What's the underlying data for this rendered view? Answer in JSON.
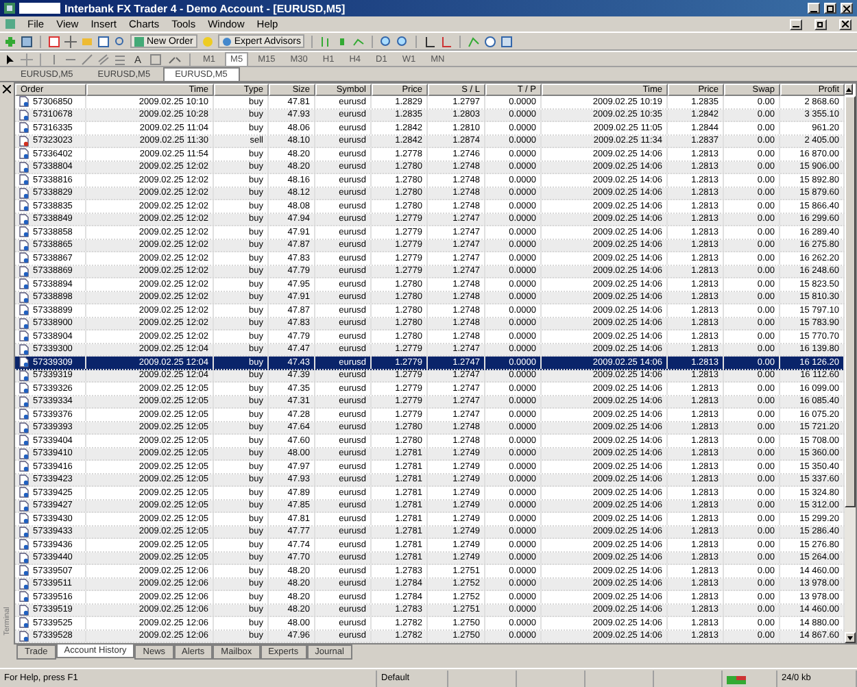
{
  "window": {
    "title": "Interbank FX Trader 4 - Demo Account - [EURUSD,M5]"
  },
  "menu": [
    "File",
    "View",
    "Insert",
    "Charts",
    "Tools",
    "Window",
    "Help"
  ],
  "toolbar": {
    "new_order": "New Order",
    "expert_advisors": "Expert Advisors"
  },
  "drawing_toolbar": {
    "text_tool": "A"
  },
  "timeframes": [
    {
      "label": "M1",
      "selected": false
    },
    {
      "label": "M5",
      "selected": true
    },
    {
      "label": "M15",
      "selected": false
    },
    {
      "label": "M30",
      "selected": false
    },
    {
      "label": "H1",
      "selected": false
    },
    {
      "label": "H4",
      "selected": false
    },
    {
      "label": "D1",
      "selected": false
    },
    {
      "label": "W1",
      "selected": false
    },
    {
      "label": "MN",
      "selected": false
    }
  ],
  "chart_tabs": [
    {
      "label": "EURUSD,M5",
      "selected": false
    },
    {
      "label": "EURUSD,M5",
      "selected": false
    },
    {
      "label": "EURUSD,M5",
      "selected": true
    }
  ],
  "terminal": {
    "side_label": "Terminal"
  },
  "table": {
    "columns": [
      "Order",
      "Time",
      "Type",
      "Size",
      "Symbol",
      "Price",
      "S / L",
      "T / P",
      "Time",
      "Price",
      "Swap",
      "Profit"
    ],
    "rows": [
      {
        "kind": "buy",
        "selected": false,
        "cells": [
          "57306850",
          "2009.02.25 10:10",
          "buy",
          "47.81",
          "eurusd",
          "1.2829",
          "1.2797",
          "0.0000",
          "2009.02.25 10:19",
          "1.2835",
          "0.00",
          "2 868.60"
        ]
      },
      {
        "kind": "buy",
        "selected": false,
        "cells": [
          "57310678",
          "2009.02.25 10:28",
          "buy",
          "47.93",
          "eurusd",
          "1.2835",
          "1.2803",
          "0.0000",
          "2009.02.25 10:35",
          "1.2842",
          "0.00",
          "3 355.10"
        ]
      },
      {
        "kind": "buy",
        "selected": false,
        "cells": [
          "57316335",
          "2009.02.25 11:04",
          "buy",
          "48.06",
          "eurusd",
          "1.2842",
          "1.2810",
          "0.0000",
          "2009.02.25 11:05",
          "1.2844",
          "0.00",
          "961.20"
        ]
      },
      {
        "kind": "sell",
        "selected": false,
        "cells": [
          "57323023",
          "2009.02.25 11:30",
          "sell",
          "48.10",
          "eurusd",
          "1.2842",
          "1.2874",
          "0.0000",
          "2009.02.25 11:34",
          "1.2837",
          "0.00",
          "2 405.00"
        ]
      },
      {
        "kind": "buy",
        "selected": false,
        "cells": [
          "57336402",
          "2009.02.25 11:54",
          "buy",
          "48.20",
          "eurusd",
          "1.2778",
          "1.2746",
          "0.0000",
          "2009.02.25 14:06",
          "1.2813",
          "0.00",
          "16 870.00"
        ]
      },
      {
        "kind": "buy",
        "selected": false,
        "cells": [
          "57338804",
          "2009.02.25 12:02",
          "buy",
          "48.20",
          "eurusd",
          "1.2780",
          "1.2748",
          "0.0000",
          "2009.02.25 14:06",
          "1.2813",
          "0.00",
          "15 906.00"
        ]
      },
      {
        "kind": "buy",
        "selected": false,
        "cells": [
          "57338816",
          "2009.02.25 12:02",
          "buy",
          "48.16",
          "eurusd",
          "1.2780",
          "1.2748",
          "0.0000",
          "2009.02.25 14:06",
          "1.2813",
          "0.00",
          "15 892.80"
        ]
      },
      {
        "kind": "buy",
        "selected": false,
        "cells": [
          "57338829",
          "2009.02.25 12:02",
          "buy",
          "48.12",
          "eurusd",
          "1.2780",
          "1.2748",
          "0.0000",
          "2009.02.25 14:06",
          "1.2813",
          "0.00",
          "15 879.60"
        ]
      },
      {
        "kind": "buy",
        "selected": false,
        "cells": [
          "57338835",
          "2009.02.25 12:02",
          "buy",
          "48.08",
          "eurusd",
          "1.2780",
          "1.2748",
          "0.0000",
          "2009.02.25 14:06",
          "1.2813",
          "0.00",
          "15 866.40"
        ]
      },
      {
        "kind": "buy",
        "selected": false,
        "cells": [
          "57338849",
          "2009.02.25 12:02",
          "buy",
          "47.94",
          "eurusd",
          "1.2779",
          "1.2747",
          "0.0000",
          "2009.02.25 14:06",
          "1.2813",
          "0.00",
          "16 299.60"
        ]
      },
      {
        "kind": "buy",
        "selected": false,
        "cells": [
          "57338858",
          "2009.02.25 12:02",
          "buy",
          "47.91",
          "eurusd",
          "1.2779",
          "1.2747",
          "0.0000",
          "2009.02.25 14:06",
          "1.2813",
          "0.00",
          "16 289.40"
        ]
      },
      {
        "kind": "buy",
        "selected": false,
        "cells": [
          "57338865",
          "2009.02.25 12:02",
          "buy",
          "47.87",
          "eurusd",
          "1.2779",
          "1.2747",
          "0.0000",
          "2009.02.25 14:06",
          "1.2813",
          "0.00",
          "16 275.80"
        ]
      },
      {
        "kind": "buy",
        "selected": false,
        "cells": [
          "57338867",
          "2009.02.25 12:02",
          "buy",
          "47.83",
          "eurusd",
          "1.2779",
          "1.2747",
          "0.0000",
          "2009.02.25 14:06",
          "1.2813",
          "0.00",
          "16 262.20"
        ]
      },
      {
        "kind": "buy",
        "selected": false,
        "cells": [
          "57338869",
          "2009.02.25 12:02",
          "buy",
          "47.79",
          "eurusd",
          "1.2779",
          "1.2747",
          "0.0000",
          "2009.02.25 14:06",
          "1.2813",
          "0.00",
          "16 248.60"
        ]
      },
      {
        "kind": "buy",
        "selected": false,
        "cells": [
          "57338894",
          "2009.02.25 12:02",
          "buy",
          "47.95",
          "eurusd",
          "1.2780",
          "1.2748",
          "0.0000",
          "2009.02.25 14:06",
          "1.2813",
          "0.00",
          "15 823.50"
        ]
      },
      {
        "kind": "buy",
        "selected": false,
        "cells": [
          "57338898",
          "2009.02.25 12:02",
          "buy",
          "47.91",
          "eurusd",
          "1.2780",
          "1.2748",
          "0.0000",
          "2009.02.25 14:06",
          "1.2813",
          "0.00",
          "15 810.30"
        ]
      },
      {
        "kind": "buy",
        "selected": false,
        "cells": [
          "57338899",
          "2009.02.25 12:02",
          "buy",
          "47.87",
          "eurusd",
          "1.2780",
          "1.2748",
          "0.0000",
          "2009.02.25 14:06",
          "1.2813",
          "0.00",
          "15 797.10"
        ]
      },
      {
        "kind": "buy",
        "selected": false,
        "cells": [
          "57338900",
          "2009.02.25 12:02",
          "buy",
          "47.83",
          "eurusd",
          "1.2780",
          "1.2748",
          "0.0000",
          "2009.02.25 14:06",
          "1.2813",
          "0.00",
          "15 783.90"
        ]
      },
      {
        "kind": "buy",
        "selected": false,
        "cells": [
          "57338904",
          "2009.02.25 12:02",
          "buy",
          "47.79",
          "eurusd",
          "1.2780",
          "1.2748",
          "0.0000",
          "2009.02.25 14:06",
          "1.2813",
          "0.00",
          "15 770.70"
        ]
      },
      {
        "kind": "buy",
        "selected": false,
        "cells": [
          "57339300",
          "2009.02.25 12:04",
          "buy",
          "47.47",
          "eurusd",
          "1.2779",
          "1.2747",
          "0.0000",
          "2009.02.25 14:06",
          "1.2813",
          "0.00",
          "16 139.80"
        ]
      },
      {
        "kind": "buy",
        "selected": true,
        "cells": [
          "57339309",
          "2009.02.25 12:04",
          "buy",
          "47.43",
          "eurusd",
          "1.2779",
          "1.2747",
          "0.0000",
          "2009.02.25 14:06",
          "1.2813",
          "0.00",
          "16 126.20"
        ]
      },
      {
        "kind": "buy",
        "selected": false,
        "cells": [
          "57339319",
          "2009.02.25 12:04",
          "buy",
          "47.39",
          "eurusd",
          "1.2779",
          "1.2747",
          "0.0000",
          "2009.02.25 14:06",
          "1.2813",
          "0.00",
          "16 112.60"
        ]
      },
      {
        "kind": "buy",
        "selected": false,
        "cells": [
          "57339326",
          "2009.02.25 12:05",
          "buy",
          "47.35",
          "eurusd",
          "1.2779",
          "1.2747",
          "0.0000",
          "2009.02.25 14:06",
          "1.2813",
          "0.00",
          "16 099.00"
        ]
      },
      {
        "kind": "buy",
        "selected": false,
        "cells": [
          "57339334",
          "2009.02.25 12:05",
          "buy",
          "47.31",
          "eurusd",
          "1.2779",
          "1.2747",
          "0.0000",
          "2009.02.25 14:06",
          "1.2813",
          "0.00",
          "16 085.40"
        ]
      },
      {
        "kind": "buy",
        "selected": false,
        "cells": [
          "57339376",
          "2009.02.25 12:05",
          "buy",
          "47.28",
          "eurusd",
          "1.2779",
          "1.2747",
          "0.0000",
          "2009.02.25 14:06",
          "1.2813",
          "0.00",
          "16 075.20"
        ]
      },
      {
        "kind": "buy",
        "selected": false,
        "cells": [
          "57339393",
          "2009.02.25 12:05",
          "buy",
          "47.64",
          "eurusd",
          "1.2780",
          "1.2748",
          "0.0000",
          "2009.02.25 14:06",
          "1.2813",
          "0.00",
          "15 721.20"
        ]
      },
      {
        "kind": "buy",
        "selected": false,
        "cells": [
          "57339404",
          "2009.02.25 12:05",
          "buy",
          "47.60",
          "eurusd",
          "1.2780",
          "1.2748",
          "0.0000",
          "2009.02.25 14:06",
          "1.2813",
          "0.00",
          "15 708.00"
        ]
      },
      {
        "kind": "buy",
        "selected": false,
        "cells": [
          "57339410",
          "2009.02.25 12:05",
          "buy",
          "48.00",
          "eurusd",
          "1.2781",
          "1.2749",
          "0.0000",
          "2009.02.25 14:06",
          "1.2813",
          "0.00",
          "15 360.00"
        ]
      },
      {
        "kind": "buy",
        "selected": false,
        "cells": [
          "57339416",
          "2009.02.25 12:05",
          "buy",
          "47.97",
          "eurusd",
          "1.2781",
          "1.2749",
          "0.0000",
          "2009.02.25 14:06",
          "1.2813",
          "0.00",
          "15 350.40"
        ]
      },
      {
        "kind": "buy",
        "selected": false,
        "cells": [
          "57339423",
          "2009.02.25 12:05",
          "buy",
          "47.93",
          "eurusd",
          "1.2781",
          "1.2749",
          "0.0000",
          "2009.02.25 14:06",
          "1.2813",
          "0.00",
          "15 337.60"
        ]
      },
      {
        "kind": "buy",
        "selected": false,
        "cells": [
          "57339425",
          "2009.02.25 12:05",
          "buy",
          "47.89",
          "eurusd",
          "1.2781",
          "1.2749",
          "0.0000",
          "2009.02.25 14:06",
          "1.2813",
          "0.00",
          "15 324.80"
        ]
      },
      {
        "kind": "buy",
        "selected": false,
        "cells": [
          "57339427",
          "2009.02.25 12:05",
          "buy",
          "47.85",
          "eurusd",
          "1.2781",
          "1.2749",
          "0.0000",
          "2009.02.25 14:06",
          "1.2813",
          "0.00",
          "15 312.00"
        ]
      },
      {
        "kind": "buy",
        "selected": false,
        "cells": [
          "57339430",
          "2009.02.25 12:05",
          "buy",
          "47.81",
          "eurusd",
          "1.2781",
          "1.2749",
          "0.0000",
          "2009.02.25 14:06",
          "1.2813",
          "0.00",
          "15 299.20"
        ]
      },
      {
        "kind": "buy",
        "selected": false,
        "cells": [
          "57339433",
          "2009.02.25 12:05",
          "buy",
          "47.77",
          "eurusd",
          "1.2781",
          "1.2749",
          "0.0000",
          "2009.02.25 14:06",
          "1.2813",
          "0.00",
          "15 286.40"
        ]
      },
      {
        "kind": "buy",
        "selected": false,
        "cells": [
          "57339436",
          "2009.02.25 12:05",
          "buy",
          "47.74",
          "eurusd",
          "1.2781",
          "1.2749",
          "0.0000",
          "2009.02.25 14:06",
          "1.2813",
          "0.00",
          "15 276.80"
        ]
      },
      {
        "kind": "buy",
        "selected": false,
        "cells": [
          "57339440",
          "2009.02.25 12:05",
          "buy",
          "47.70",
          "eurusd",
          "1.2781",
          "1.2749",
          "0.0000",
          "2009.02.25 14:06",
          "1.2813",
          "0.00",
          "15 264.00"
        ]
      },
      {
        "kind": "buy",
        "selected": false,
        "cells": [
          "57339507",
          "2009.02.25 12:06",
          "buy",
          "48.20",
          "eurusd",
          "1.2783",
          "1.2751",
          "0.0000",
          "2009.02.25 14:06",
          "1.2813",
          "0.00",
          "14 460.00"
        ]
      },
      {
        "kind": "buy",
        "selected": false,
        "cells": [
          "57339511",
          "2009.02.25 12:06",
          "buy",
          "48.20",
          "eurusd",
          "1.2784",
          "1.2752",
          "0.0000",
          "2009.02.25 14:06",
          "1.2813",
          "0.00",
          "13 978.00"
        ]
      },
      {
        "kind": "buy",
        "selected": false,
        "cells": [
          "57339516",
          "2009.02.25 12:06",
          "buy",
          "48.20",
          "eurusd",
          "1.2784",
          "1.2752",
          "0.0000",
          "2009.02.25 14:06",
          "1.2813",
          "0.00",
          "13 978.00"
        ]
      },
      {
        "kind": "buy",
        "selected": false,
        "cells": [
          "57339519",
          "2009.02.25 12:06",
          "buy",
          "48.20",
          "eurusd",
          "1.2783",
          "1.2751",
          "0.0000",
          "2009.02.25 14:06",
          "1.2813",
          "0.00",
          "14 460.00"
        ]
      },
      {
        "kind": "buy",
        "selected": false,
        "cells": [
          "57339525",
          "2009.02.25 12:06",
          "buy",
          "48.00",
          "eurusd",
          "1.2782",
          "1.2750",
          "0.0000",
          "2009.02.25 14:06",
          "1.2813",
          "0.00",
          "14 880.00"
        ]
      },
      {
        "kind": "buy",
        "selected": false,
        "cells": [
          "57339528",
          "2009.02.25 12:06",
          "buy",
          "47.96",
          "eurusd",
          "1.2782",
          "1.2750",
          "0.0000",
          "2009.02.25 14:06",
          "1.2813",
          "0.00",
          "14 867.60"
        ]
      }
    ]
  },
  "bottom_tabs": [
    {
      "label": "Trade",
      "selected": false
    },
    {
      "label": "Account History",
      "selected": true
    },
    {
      "label": "News",
      "selected": false
    },
    {
      "label": "Alerts",
      "selected": false
    },
    {
      "label": "Mailbox",
      "selected": false
    },
    {
      "label": "Experts",
      "selected": false
    },
    {
      "label": "Journal",
      "selected": false
    }
  ],
  "status_bar": {
    "help": "For Help, press F1",
    "profile": "Default",
    "traffic": "24/0 kb"
  }
}
